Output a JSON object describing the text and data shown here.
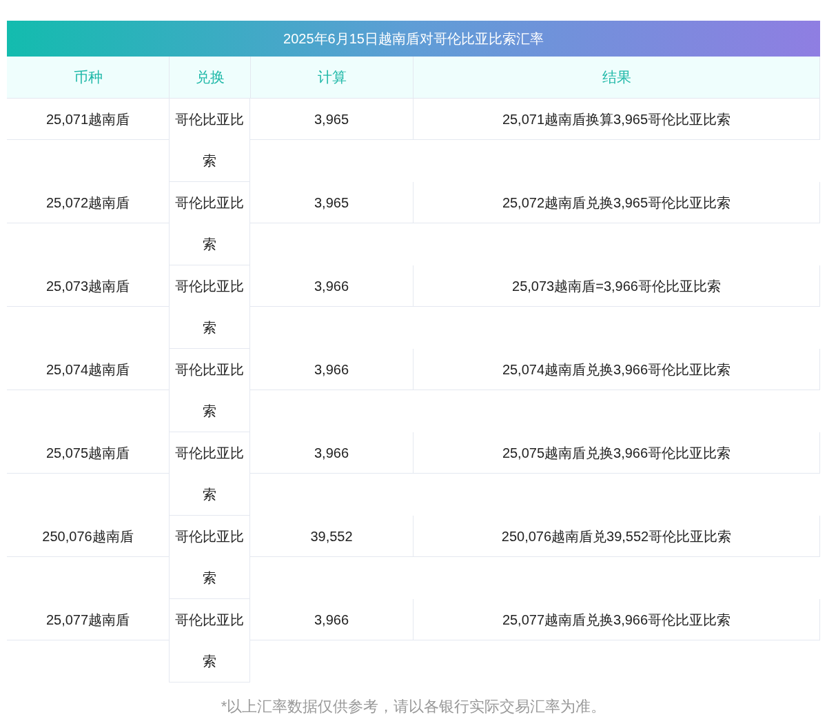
{
  "title": "2025年6月15日越南盾对哥伦比亚比索汇率",
  "columns": [
    "币种",
    "兑换",
    "计算",
    "结果"
  ],
  "rows": [
    {
      "currency": "25,071越南盾",
      "exchange": "哥伦比亚比索",
      "calc": "3,965",
      "result": "25,071越南盾换算3,965哥伦比亚比索"
    },
    {
      "currency": "25,072越南盾",
      "exchange": "哥伦比亚比索",
      "calc": "3,965",
      "result": "25,072越南盾兑换3,965哥伦比亚比索"
    },
    {
      "currency": "25,073越南盾",
      "exchange": "哥伦比亚比索",
      "calc": "3,966",
      "result": "25,073越南盾=3,966哥伦比亚比索"
    },
    {
      "currency": "25,074越南盾",
      "exchange": "哥伦比亚比索",
      "calc": "3,966",
      "result": "25,074越南盾兑换3,966哥伦比亚比索"
    },
    {
      "currency": "25,075越南盾",
      "exchange": "哥伦比亚比索",
      "calc": "3,966",
      "result": "25,075越南盾兑换3,966哥伦比亚比索"
    },
    {
      "currency": "250,076越南盾",
      "exchange": "哥伦比亚比索",
      "calc": "39,552",
      "result": "250,076越南盾兑39,552哥伦比亚比索"
    },
    {
      "currency": "25,077越南盾",
      "exchange": "哥伦比亚比索",
      "calc": "3,966",
      "result": "25,077越南盾兑换3,966哥伦比亚比索"
    }
  ],
  "note": "*以上汇率数据仅供参考，请以各银行实际交易汇率为准。"
}
